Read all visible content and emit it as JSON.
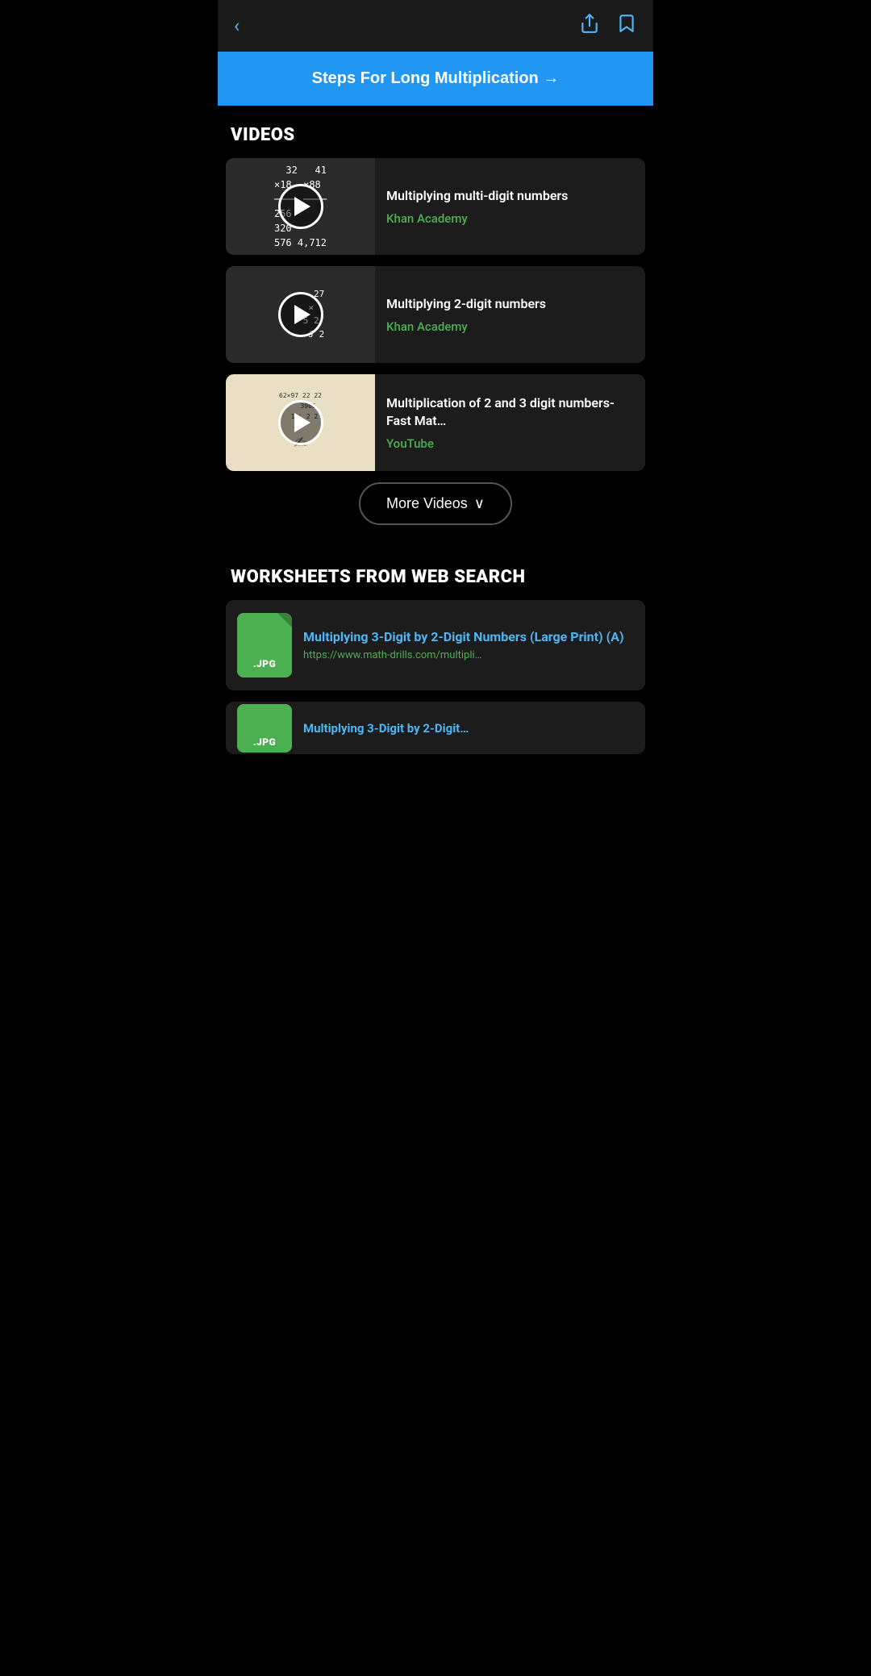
{
  "topBar": {
    "backLabel": "‹",
    "shareIconLabel": "share",
    "bookmarkIconLabel": "bookmark"
  },
  "banner": {
    "label": "Steps For Long Multiplication →"
  },
  "videosSection": {
    "header": "VIDEOS",
    "videos": [
      {
        "id": "v1",
        "title": "Multiplying multi-digit numbers",
        "source": "Khan Academy",
        "thumbType": "math1"
      },
      {
        "id": "v2",
        "title": "Multiplying 2-digit numbers",
        "source": "Khan Academy",
        "thumbType": "math2"
      },
      {
        "id": "v3",
        "title": "Multiplication of 2 and 3 digit numbers-Fast Mat…",
        "source": "YouTube",
        "thumbType": "handwriting"
      }
    ],
    "moreVideosLabel": "More Videos",
    "moreVideosChevron": "⌄"
  },
  "worksheetsSection": {
    "header": "WORKSHEETS FROM WEB SEARCH",
    "worksheets": [
      {
        "id": "w1",
        "iconLabel": ".JPG",
        "title": "Multiplying 3-Digit by 2-Digit Numbers (Large Print) (A)",
        "url": "https://www.math-drills.com/multipli…"
      },
      {
        "id": "w2",
        "iconLabel": ".JPG",
        "title": "Multiplying 3-Digit by 2-Digit…",
        "url": ""
      }
    ]
  }
}
